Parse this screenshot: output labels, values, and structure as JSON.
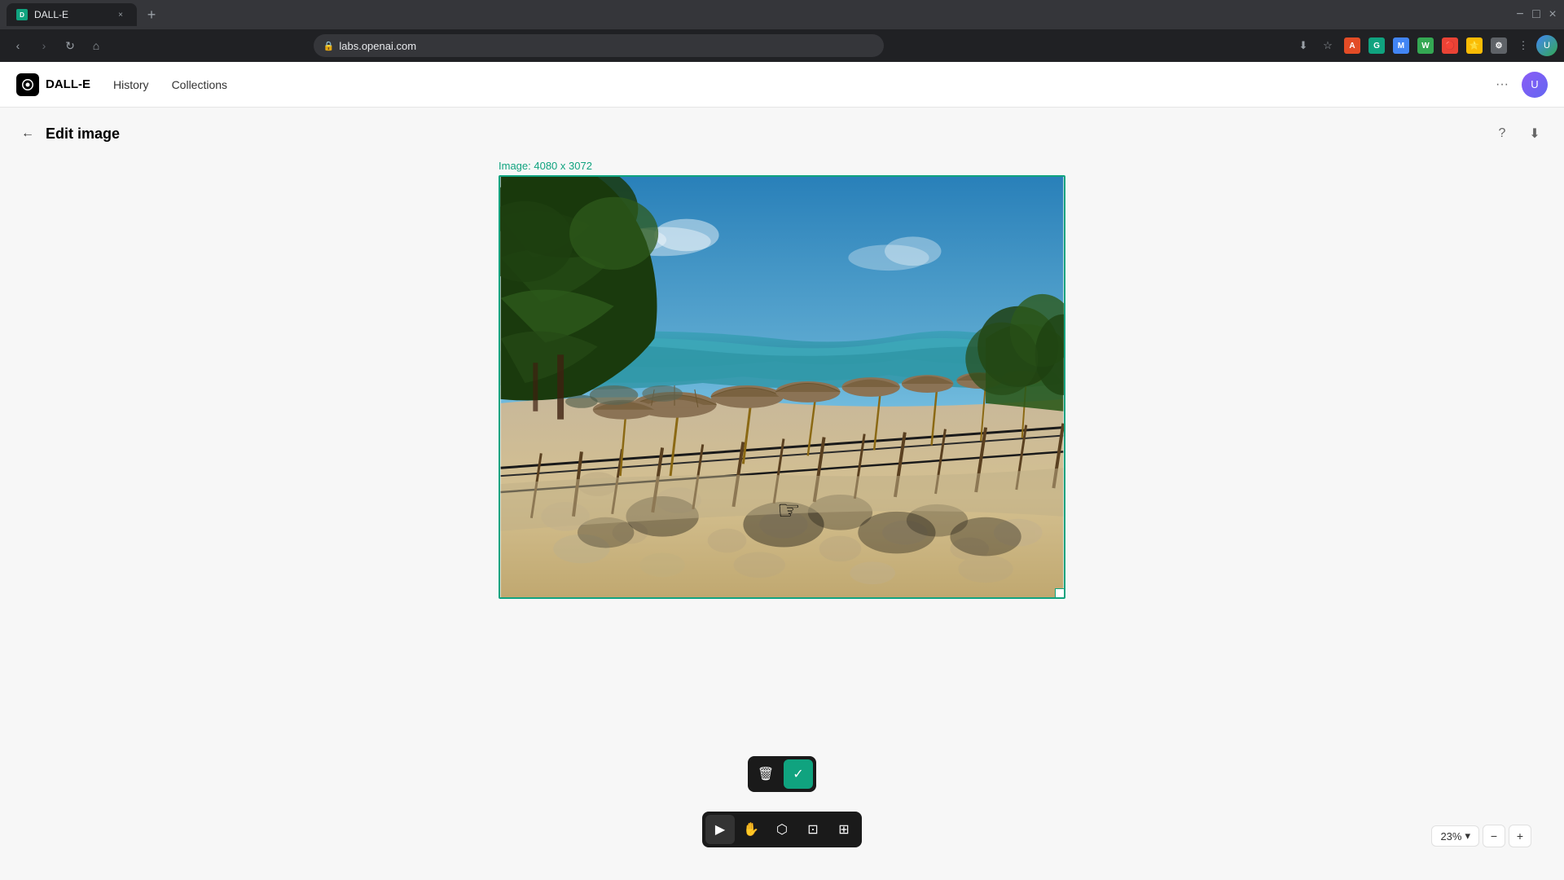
{
  "browser": {
    "tab_title": "DALL-E",
    "url": "labs.openai.com",
    "tab_close": "×",
    "tab_new": "+",
    "window_minimize": "−",
    "window_maximize": "□",
    "window_close": "×"
  },
  "nav": {
    "app_name": "DALL-E",
    "history_label": "History",
    "collections_label": "Collections",
    "more_label": "···"
  },
  "page": {
    "back_label": "←",
    "edit_image_title": "Edit image",
    "image_dimensions": "Image: 4080 x 3072",
    "zoom_level": "23%",
    "zoom_minus": "−",
    "zoom_plus": "+"
  },
  "float_toolbar": {
    "delete_label": "🗑",
    "confirm_label": "✓"
  },
  "tools": {
    "select_label": "▶",
    "hand_label": "✋",
    "lasso_label": "⬡",
    "crop_label": "⊡",
    "edit_label": "⊞"
  },
  "icons": {
    "help": "?",
    "download": "⬇",
    "more": "···"
  }
}
